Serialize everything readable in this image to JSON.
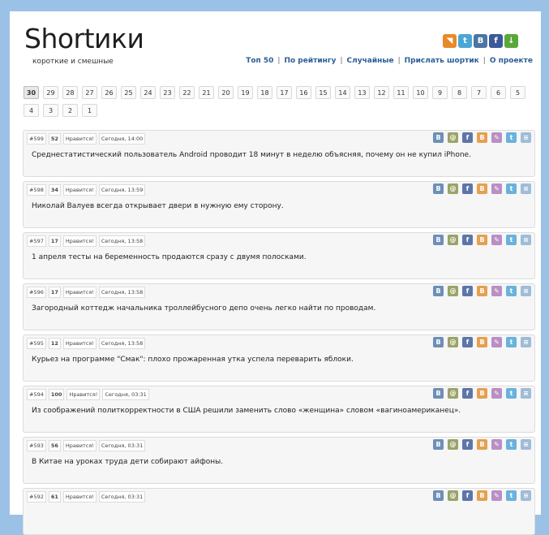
{
  "site": {
    "logo": "Shortики",
    "tagline": "короткие и смешные"
  },
  "share_icons": [
    {
      "name": "rss-icon",
      "glyph": "◥",
      "color": "#e88a2a"
    },
    {
      "name": "twitter-icon",
      "glyph": "t",
      "color": "#4aa6d6"
    },
    {
      "name": "vk-icon",
      "glyph": "B",
      "color": "#4c75a3"
    },
    {
      "name": "facebook-icon",
      "glyph": "f",
      "color": "#3b5998"
    },
    {
      "name": "download-icon",
      "glyph": "↓",
      "color": "#5aa83a"
    }
  ],
  "nav": {
    "items": [
      "Топ 50",
      "По рейтингу",
      "Случайные",
      "Прислать шортик",
      "О проекте"
    ]
  },
  "pagination": {
    "current": "30",
    "pages": [
      "30",
      "29",
      "28",
      "27",
      "26",
      "25",
      "24",
      "23",
      "22",
      "21",
      "20",
      "19",
      "18",
      "17",
      "16",
      "15",
      "14",
      "13",
      "12",
      "11",
      "10",
      "9",
      "8",
      "7",
      "6",
      "5",
      "4",
      "3",
      "2",
      "1"
    ]
  },
  "posts": [
    {
      "id": "#599",
      "score": "52",
      "like": "Нравится!",
      "time": "Сегодня, 14:00",
      "text": "Среднестатистический пользователь Android проводит 18 минут в неделю объясняя, почему он не купил iPhone."
    },
    {
      "id": "#598",
      "score": "34",
      "like": "Нравится!",
      "time": "Сегодня, 13:59",
      "text": "Николай Валуев всегда открывает двери в нужную ему сторону."
    },
    {
      "id": "#597",
      "score": "17",
      "like": "Нравится!",
      "time": "Сегодня, 13:58",
      "text": "1 апреля тесты на беременность продаются сразу с двумя полосками."
    },
    {
      "id": "#596",
      "score": "17",
      "like": "Нравится!",
      "time": "Сегодня, 13:58",
      "text": "Загородный коттедж начальника троллейбусного депо очень легко найти по проводам."
    },
    {
      "id": "#595",
      "score": "12",
      "like": "Нравится!",
      "time": "Сегодня, 13:58",
      "text": "Курьез на программе \"Смак\": плохо прожаренная утка успела переварить яблоки."
    },
    {
      "id": "#594",
      "score": "100",
      "like": "Нравится!",
      "time": "Сегодня, 03:31",
      "text": "Из соображений политкорректности в США решили заменить слово «женщина» словом «вагиноамериканец»."
    },
    {
      "id": "#593",
      "score": "56",
      "like": "Нравится!",
      "time": "Сегодня, 03:31",
      "text": "В Китае на уроках труда дети собирают айфоны."
    },
    {
      "id": "#592",
      "score": "61",
      "like": "Нравится!",
      "time": "Сегодня, 03:31",
      "text": ""
    }
  ],
  "post_icons": [
    {
      "name": "vk-share-icon",
      "glyph": "B",
      "color": "#6d8fb8"
    },
    {
      "name": "mail-share-icon",
      "glyph": "@",
      "color": "#9aa36a"
    },
    {
      "name": "facebook-share-icon",
      "glyph": "f",
      "color": "#5c76a8"
    },
    {
      "name": "blogger-share-icon",
      "glyph": "B",
      "color": "#e5a050"
    },
    {
      "name": "pencil-share-icon",
      "glyph": "✎",
      "color": "#b98fc4"
    },
    {
      "name": "twitter-share-icon",
      "glyph": "t",
      "color": "#6ab2dc"
    },
    {
      "name": "embed-share-icon",
      "glyph": "≡",
      "color": "#9fbcd8"
    }
  ]
}
